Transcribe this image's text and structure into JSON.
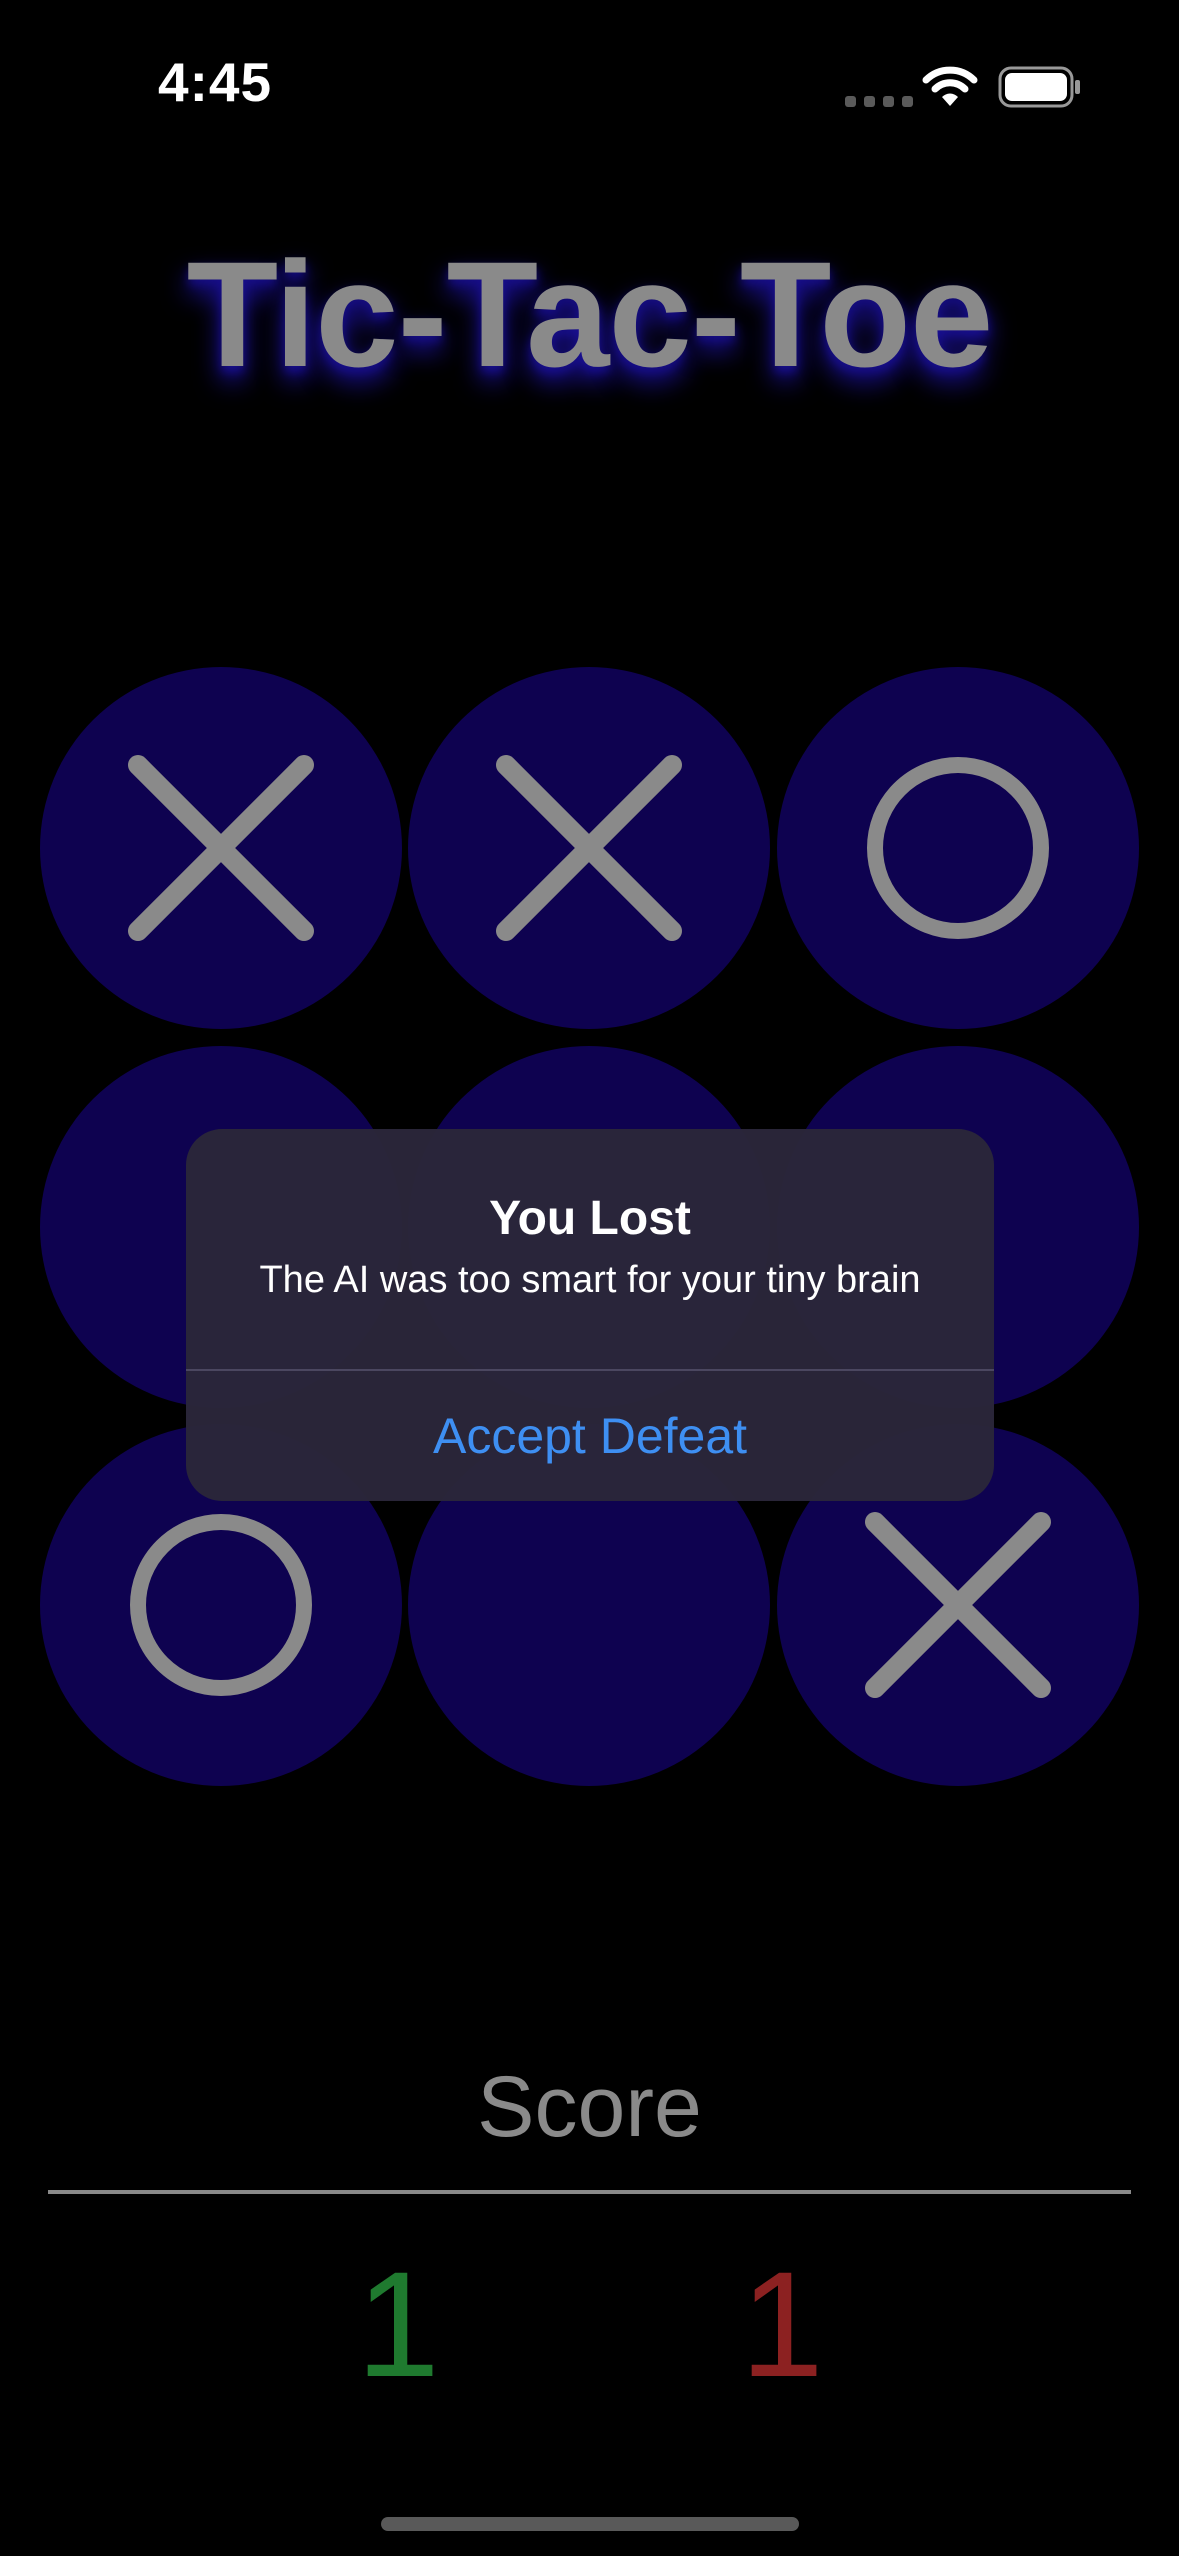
{
  "status_bar": {
    "time": "4:45",
    "signal_icon": "cellular-signal-icon",
    "wifi_icon": "wifi-icon",
    "battery_icon": "battery-full-icon"
  },
  "title": "Tic-Tac-Toe",
  "board": {
    "cells": [
      "X",
      "X",
      "O",
      "",
      "",
      "",
      "O",
      "",
      "X"
    ],
    "colors": {
      "cell": "#0e0250",
      "mark": "#8a8a8a"
    }
  },
  "alert": {
    "title": "You Lost",
    "message": "The AI was too smart for your tiny brain",
    "button_label": "Accept Defeat",
    "button_color": "#3e8ff2"
  },
  "score": {
    "label": "Score",
    "player": "1",
    "ai": "1",
    "player_color": "#1f7a2f",
    "ai_color": "#8c2121"
  }
}
